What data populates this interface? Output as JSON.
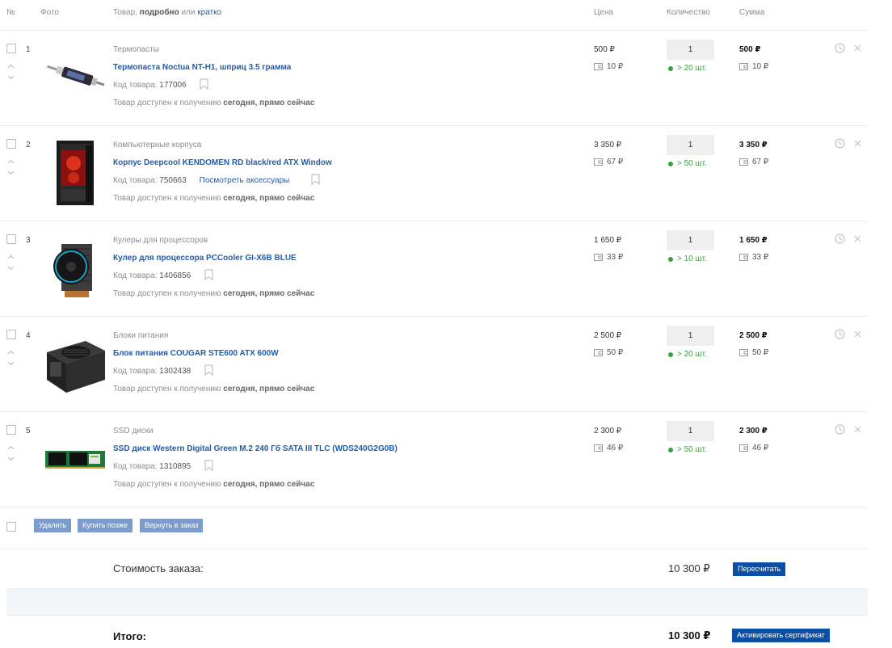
{
  "header": {
    "num": "№",
    "photo": "Фото",
    "product_prefix": "Товар, ",
    "product_detailed": "подробно",
    "product_or": " или ",
    "product_brief": "кратко",
    "price": "Цена",
    "quantity": "Количество",
    "sum": "Сумма"
  },
  "items": [
    {
      "num": "1",
      "category": "Термопасты",
      "title": "Термопаста Noctua NT-H1, шприц 3.5 грамма",
      "code_label": "Код товара: ",
      "code": "177006",
      "accessories": "",
      "avail_prefix": "Товар доступен к получению ",
      "avail_when": "сегодня, прямо сейчас",
      "price": "500 ₽",
      "bonus": "10 ₽",
      "qty": "1",
      "stock": "> 20 шт.",
      "sum": "500 ₽",
      "sum_bonus": "10 ₽"
    },
    {
      "num": "2",
      "category": "Компьютерные корпуса",
      "title": "Корпус Deepcool KENDOMEN RD black/red ATX Window",
      "code_label": "Код товара: ",
      "code": "750663",
      "accessories": "Посмотреть аксессуары",
      "avail_prefix": "Товар доступен к получению ",
      "avail_when": "сегодня, прямо сейчас",
      "price": "3 350 ₽",
      "bonus": "67 ₽",
      "qty": "1",
      "stock": "> 50 шт.",
      "sum": "3 350 ₽",
      "sum_bonus": "67 ₽"
    },
    {
      "num": "3",
      "category": "Кулеры для процессоров",
      "title": "Кулер для процессора PCCooler GI-X6B BLUE",
      "code_label": "Код товара: ",
      "code": "1406856",
      "accessories": "",
      "avail_prefix": "Товар доступен к получению ",
      "avail_when": "сегодня, прямо сейчас",
      "price": "1 650 ₽",
      "bonus": "33 ₽",
      "qty": "1",
      "stock": "> 10 шт.",
      "sum": "1 650 ₽",
      "sum_bonus": "33 ₽"
    },
    {
      "num": "4",
      "category": "Блоки питания",
      "title": "Блок питания COUGAR STE600 ATX 600W",
      "code_label": "Код товара: ",
      "code": "1302438",
      "accessories": "",
      "avail_prefix": "Товар доступен к получению ",
      "avail_when": "сегодня, прямо сейчас",
      "price": "2 500 ₽",
      "bonus": "50 ₽",
      "qty": "1",
      "stock": "> 20 шт.",
      "sum": "2 500 ₽",
      "sum_bonus": "50 ₽"
    },
    {
      "num": "5",
      "category": "SSD диски",
      "title": "SSD диск Western Digital Green M.2 240 Гб SATA III TLC (WDS240G2G0B)",
      "code_label": "Код товара: ",
      "code": "1310895",
      "accessories": "",
      "avail_prefix": "Товар доступен к получению ",
      "avail_when": "сегодня, прямо сейчас",
      "price": "2 300 ₽",
      "bonus": "46 ₽",
      "qty": "1",
      "stock": "> 50 шт.",
      "sum": "2 300 ₽",
      "sum_bonus": "46 ₽"
    }
  ],
  "actions": {
    "delete": "Удалить",
    "buy_later": "Купить позже",
    "return": "Вернуть в заказ"
  },
  "summary": {
    "cost_label": "Стоимость заказа:",
    "cost_value": "10 300 ₽",
    "recalc": "Пересчитать",
    "total_label": "Итого:",
    "total_value": "10 300 ₽",
    "activate": "Активировать сертификат"
  },
  "colors": {
    "link": "#1e5cae",
    "stock": "#37a23f",
    "primary_button": "#0b4ea6",
    "secondary_button": "#7c9ccd"
  }
}
